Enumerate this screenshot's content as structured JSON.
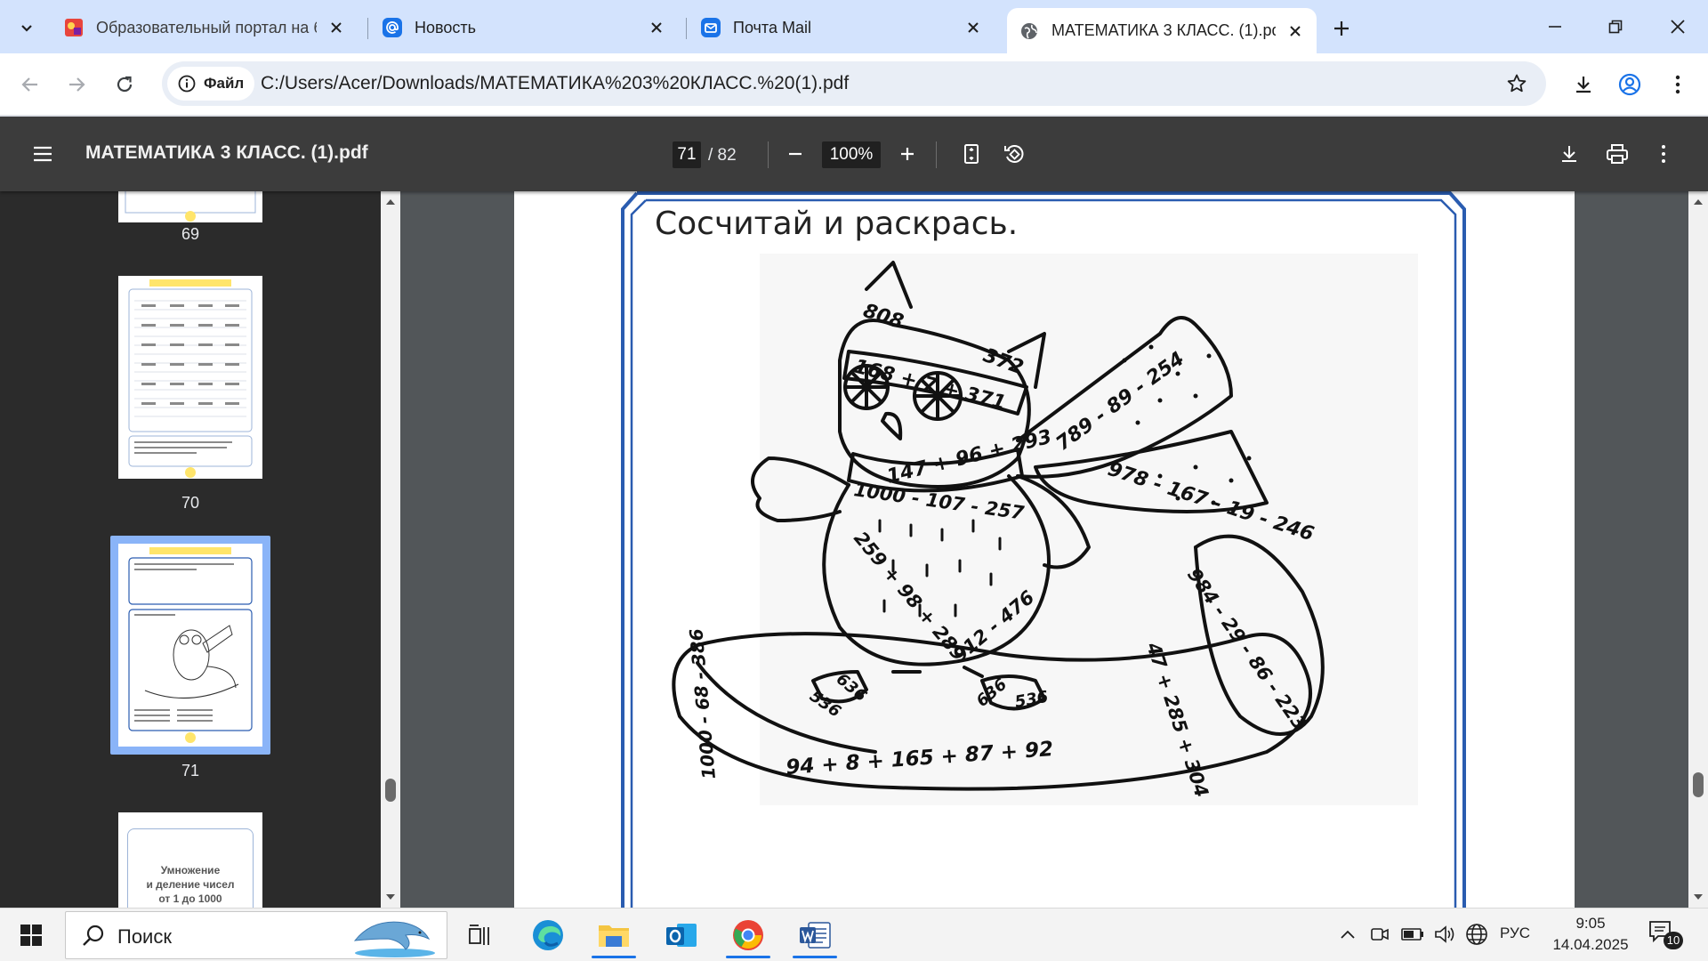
{
  "browser": {
    "tabs": [
      {
        "title": "Образовательный портал на б",
        "icon": "portal-favicon",
        "active": false
      },
      {
        "title": "Новость",
        "icon": "mail-at-icon",
        "active": false
      },
      {
        "title": "Почта Mail",
        "icon": "mail-envelope-icon",
        "active": false
      },
      {
        "title": "МАТЕМАТИКА 3 КЛАСС. (1).pd",
        "icon": "globe-icon",
        "active": true
      }
    ],
    "site_chip": "Файл",
    "url": "C:/Users/Acer/Downloads/МАТЕМАТИКА%203%20КЛАСС.%20(1).pdf"
  },
  "pdf_viewer": {
    "title": "МАТЕМАТИКА 3 КЛАСС. (1).pdf",
    "current_page": "71",
    "total_pages": "/ 82",
    "zoom": "100%"
  },
  "sidebar": {
    "thumbnails": [
      {
        "label": "69"
      },
      {
        "label": "70"
      },
      {
        "label": "71",
        "selected": true
      },
      {
        "label": "",
        "cover_text_1": "Умножение",
        "cover_text_2": "и деление чисел",
        "cover_text_3": "от 1 до 1000"
      }
    ]
  },
  "document": {
    "heading": "Сосчитай и раскрась.",
    "expressions": [
      "808",
      "372",
      "168 + 7 + 371",
      "789 - 89 - 254",
      "147 + 96 + 293",
      "1000 - 107 - 257",
      "978 - 167 - 19 - 246",
      "259 + 98 + 289",
      "984 - 29 - 86 - 223",
      "47 + 285 + 304",
      "912 - 476",
      "636",
      "536",
      "636",
      "536",
      "1000 - 68 - 386",
      "94 + 8 + 165 + 87 + 92"
    ]
  },
  "taskbar": {
    "search_placeholder": "Поиск",
    "language": "РУС",
    "time": "9:05",
    "date": "14.04.2025",
    "notification_count": "10"
  },
  "colors": {
    "tabstrip_bg": "#d3e3fd",
    "pdf_toolbar_bg": "#3c3c3c",
    "sidebar_bg": "#2b2b2b",
    "viewer_bg": "#525659",
    "page_frame": "#2a5cb0",
    "selected_thumb": "#8ab4f8",
    "accent": "#1a73e8"
  }
}
